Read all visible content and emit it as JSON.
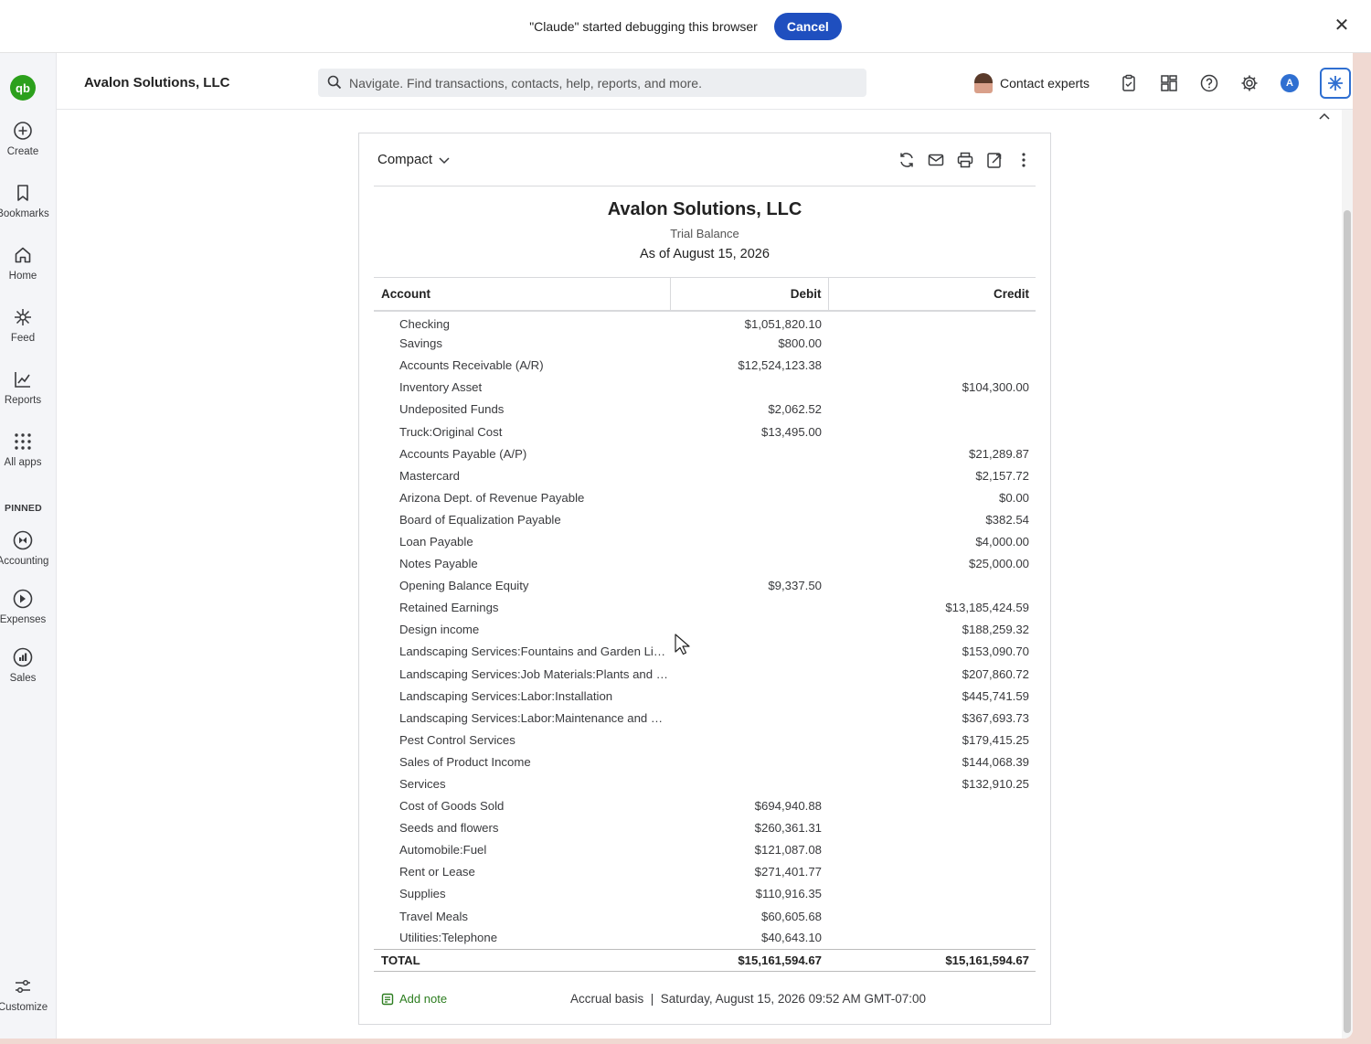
{
  "banner": {
    "message": "\"Claude\" started debugging this browser",
    "cancel_label": "Cancel",
    "close_glyph": "✕"
  },
  "sidebar": {
    "logo_text": "qb",
    "items": [
      {
        "label": "Create",
        "icon": "plus-circle-icon"
      },
      {
        "label": "Bookmarks",
        "icon": "bookmark-icon"
      },
      {
        "label": "Home",
        "icon": "home-icon"
      },
      {
        "label": "Feed",
        "icon": "sparkle-icon"
      },
      {
        "label": "Reports",
        "icon": "chart-line-icon"
      },
      {
        "label": "All apps",
        "icon": "grid-icon"
      }
    ],
    "pinned_label": "PINNED",
    "pinned": [
      {
        "label": "Accounting",
        "icon": "accounting-icon"
      },
      {
        "label": "Expenses",
        "icon": "expenses-icon"
      },
      {
        "label": "Sales",
        "icon": "sales-icon"
      }
    ],
    "customize_label": "Customize"
  },
  "topbar": {
    "company": "Avalon Solutions, LLC",
    "search_placeholder": "Navigate. Find transactions, contacts, help, reports, and more.",
    "contact_experts": "Contact experts",
    "user_initial": "A"
  },
  "report": {
    "view_label": "Compact",
    "company": "Avalon Solutions, LLC",
    "title": "Trial Balance",
    "as_of": "As of August 15, 2026",
    "columns": {
      "account": "Account",
      "debit": "Debit",
      "credit": "Credit"
    },
    "rows": [
      {
        "account": "Checking",
        "debit": "$1,051,820.10",
        "credit": ""
      },
      {
        "account": "Savings",
        "debit": "$800.00",
        "credit": ""
      },
      {
        "account": "Accounts Receivable (A/R)",
        "debit": "$12,524,123.38",
        "credit": ""
      },
      {
        "account": "Inventory Asset",
        "debit": "",
        "credit": "$104,300.00"
      },
      {
        "account": "Undeposited Funds",
        "debit": "$2,062.52",
        "credit": ""
      },
      {
        "account": "Truck:Original Cost",
        "debit": "$13,495.00",
        "credit": ""
      },
      {
        "account": "Accounts Payable (A/P)",
        "debit": "",
        "credit": "$21,289.87"
      },
      {
        "account": "Mastercard",
        "debit": "",
        "credit": "$2,157.72"
      },
      {
        "account": "Arizona Dept. of Revenue Payable",
        "debit": "",
        "credit": "$0.00"
      },
      {
        "account": "Board of Equalization Payable",
        "debit": "",
        "credit": "$382.54"
      },
      {
        "account": "Loan Payable",
        "debit": "",
        "credit": "$4,000.00"
      },
      {
        "account": "Notes Payable",
        "debit": "",
        "credit": "$25,000.00"
      },
      {
        "account": "Opening Balance Equity",
        "debit": "$9,337.50",
        "credit": ""
      },
      {
        "account": "Retained Earnings",
        "debit": "",
        "credit": "$13,185,424.59"
      },
      {
        "account": "Design income",
        "debit": "",
        "credit": "$188,259.32"
      },
      {
        "account": "Landscaping Services:Fountains and Garden Li…",
        "debit": "",
        "credit": "$153,090.70"
      },
      {
        "account": "Landscaping Services:Job Materials:Plants and …",
        "debit": "",
        "credit": "$207,860.72"
      },
      {
        "account": "Landscaping Services:Labor:Installation",
        "debit": "",
        "credit": "$445,741.59"
      },
      {
        "account": "Landscaping Services:Labor:Maintenance and …",
        "debit": "",
        "credit": "$367,693.73"
      },
      {
        "account": "Pest Control Services",
        "debit": "",
        "credit": "$179,415.25"
      },
      {
        "account": "Sales of Product Income",
        "debit": "",
        "credit": "$144,068.39"
      },
      {
        "account": "Services",
        "debit": "",
        "credit": "$132,910.25"
      },
      {
        "account": "Cost of Goods Sold",
        "debit": "$694,940.88",
        "credit": ""
      },
      {
        "account": "Seeds and flowers",
        "debit": "$260,361.31",
        "credit": ""
      },
      {
        "account": "Automobile:Fuel",
        "debit": "$121,087.08",
        "credit": ""
      },
      {
        "account": "Rent or Lease",
        "debit": "$271,401.77",
        "credit": ""
      },
      {
        "account": "Supplies",
        "debit": "$110,916.35",
        "credit": ""
      },
      {
        "account": "Travel Meals",
        "debit": "$60,605.68",
        "credit": ""
      },
      {
        "account": "Utilities:Telephone",
        "debit": "$40,643.10",
        "credit": ""
      }
    ],
    "total": {
      "label": "TOTAL",
      "debit": "$15,161,594.67",
      "credit": "$15,161,594.67"
    },
    "add_note": "Add note",
    "footer_meta": "Accrual basis  |  Saturday, August 15, 2026 09:52 AM GMT-07:00"
  },
  "colors": {
    "brand_green": "#2ca01c",
    "accent_blue": "#1f4fbf",
    "note_green": "#2c7d1f"
  }
}
